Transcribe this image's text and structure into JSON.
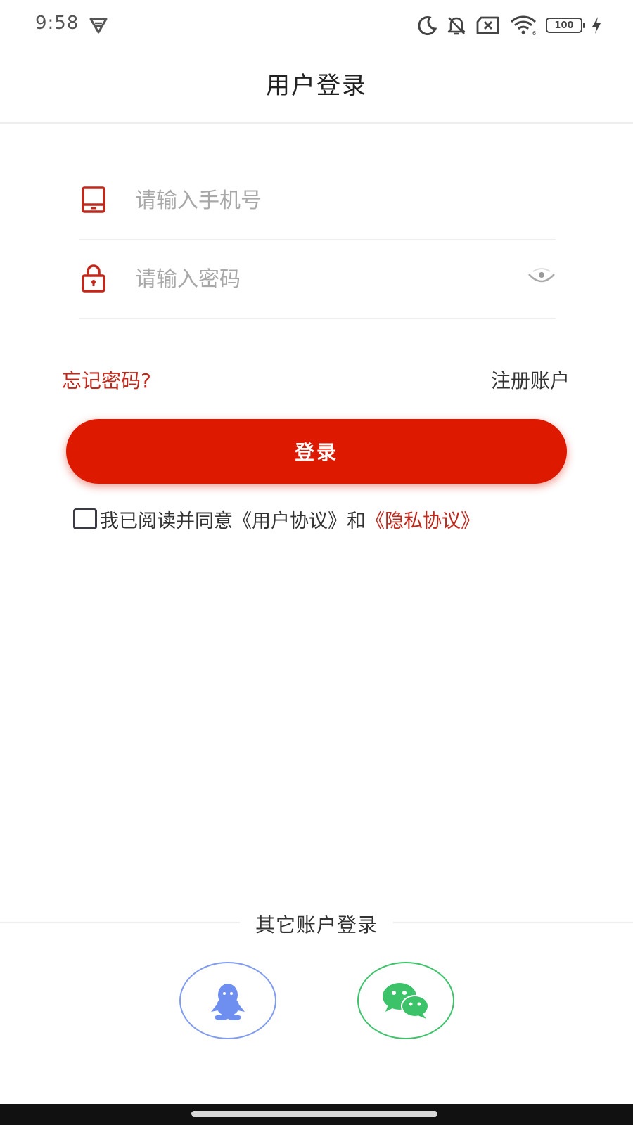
{
  "status_bar": {
    "time": "9:58",
    "battery_level": "100",
    "icons": [
      "vpn-icon",
      "moon-icon",
      "bell-off-icon",
      "sim-off-icon",
      "wifi-icon",
      "battery-icon",
      "charging-icon"
    ]
  },
  "header": {
    "title": "用户登录"
  },
  "form": {
    "phone": {
      "placeholder": "请输入手机号",
      "value": "",
      "icon": "tablet-icon"
    },
    "password": {
      "placeholder": "请输入密码",
      "value": "",
      "icon": "lock-icon",
      "toggle_icon": "eye-icon"
    },
    "forgot_label": "忘记密码?",
    "register_label": "注册账户",
    "login_label": "登录",
    "agreement": {
      "checked": false,
      "prefix": "我已阅读并同意《用户协议》和",
      "privacy_link": "《隐私协议》"
    }
  },
  "other_login": {
    "title": "其它账户登录",
    "providers": [
      {
        "icon": "qq-icon"
      },
      {
        "icon": "wechat-icon"
      }
    ]
  },
  "colors": {
    "accent": "#dd1a00",
    "link_red": "#c0281c",
    "qq_blue": "#6f8ff0",
    "wechat_green": "#3cc36a"
  }
}
